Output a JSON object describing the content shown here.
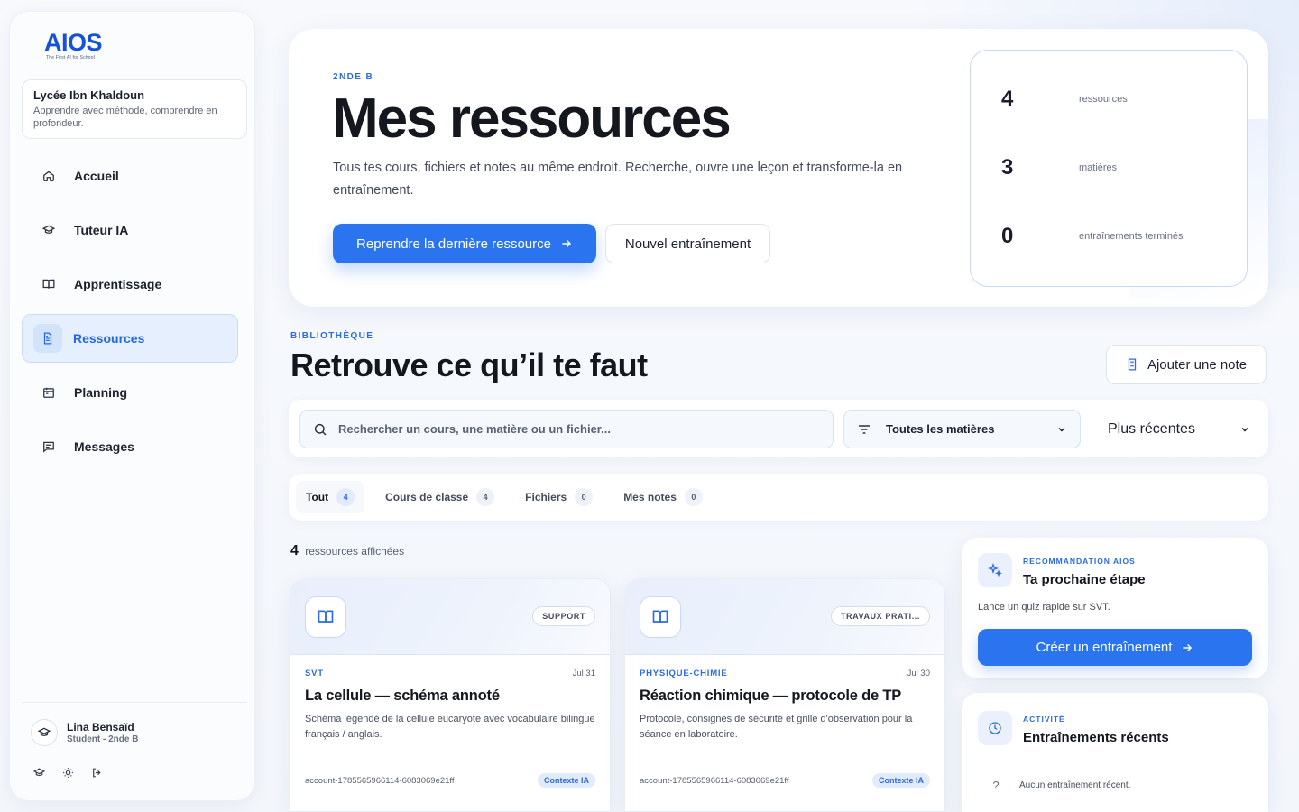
{
  "brand": {
    "logo": "AIOS",
    "tagline": "The First AI for School"
  },
  "school": {
    "name": "Lycée Ibn Khaldoun",
    "tagline": "Apprendre avec méthode, comprendre en profondeur."
  },
  "nav": [
    {
      "label": "Accueil",
      "icon": "home-icon"
    },
    {
      "label": "Tuteur IA",
      "icon": "graduation-cap-icon"
    },
    {
      "label": "Apprentissage",
      "icon": "book-open-icon"
    },
    {
      "label": "Ressources",
      "icon": "file-icon",
      "active": true
    },
    {
      "label": "Planning",
      "icon": "calendar-icon"
    },
    {
      "label": "Messages",
      "icon": "message-icon"
    }
  ],
  "user": {
    "name": "Lina Bensaïd",
    "role": "Student - 2nde B"
  },
  "hero": {
    "eyebrow": "2NDE B",
    "title": "Mes ressources",
    "description": "Tous tes cours, fichiers et notes au même endroit. Recherche, ouvre une leçon et transforme-la en entraînement.",
    "primary_cta": "Reprendre la dernière ressource",
    "secondary_cta": "Nouvel entraînement"
  },
  "stats": [
    {
      "value": "4",
      "label": "ressources"
    },
    {
      "value": "3",
      "label": "matières"
    },
    {
      "value": "0",
      "label": "entraînements terminés"
    }
  ],
  "library": {
    "eyebrow": "BIBLIOTHÈQUE",
    "title": "Retrouve ce qu’il te faut",
    "add_note": "Ajouter une note",
    "search_placeholder": "Rechercher un cours, une matière ou un fichier...",
    "subject_filter": "Toutes les matières",
    "sort": "Plus récentes"
  },
  "tabs": [
    {
      "label": "Tout",
      "count": "4",
      "active": true
    },
    {
      "label": "Cours de classe",
      "count": "4"
    },
    {
      "label": "Fichiers",
      "count": "0"
    },
    {
      "label": "Mes notes",
      "count": "0"
    }
  ],
  "results": {
    "count": "4",
    "label": "ressources affichées"
  },
  "cards": [
    {
      "badge": "SUPPORT",
      "subject": "SVT",
      "date": "Jul 31",
      "title": "La cellule — schéma annoté",
      "description": "Schéma légendé de la cellule eucaryote avec vocabulaire bilingue français / anglais.",
      "id": "account-1785565966114-6083069e21ff",
      "context": "Contexte IA"
    },
    {
      "badge": "TRAVAUX PRATI...",
      "subject": "PHYSIQUE-CHIMIE",
      "date": "Jul 30",
      "title": "Réaction chimique — protocole de TP",
      "description": "Protocole, consignes de sécurité et grille d'observation pour la séance en laboratoire.",
      "id": "account-1785565966114-6083069e21ff",
      "context": "Contexte IA"
    }
  ],
  "recommendation": {
    "eyebrow": "RECOMMANDATION AIOS",
    "title": "Ta prochaine étape",
    "text": "Lance un quiz rapide sur SVT.",
    "cta": "Créer un entraînement"
  },
  "activity": {
    "eyebrow": "ACTIVITÉ",
    "title": "Entraînements récents",
    "empty": "Aucun entraînement récent."
  },
  "colors": {
    "accent": "#2b74f0",
    "brand": "#1652d6",
    "active_nav_bg": "#e6effd"
  }
}
